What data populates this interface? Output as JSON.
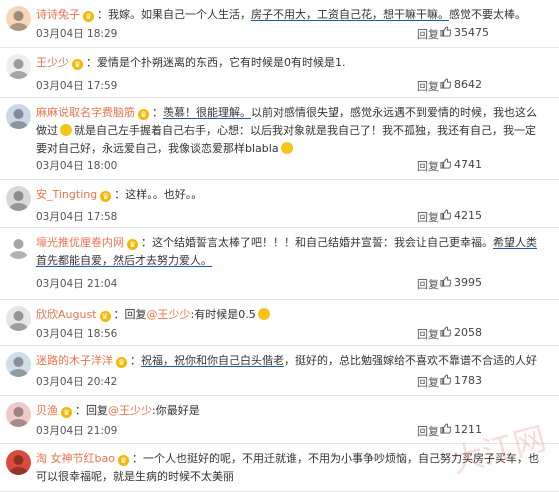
{
  "labels": {
    "reply": "回复"
  },
  "colors": {
    "username": "#eb7350",
    "vip": "#f7b600",
    "underline": "#1b5ea8",
    "divider": "#e6e6e6"
  },
  "watermark_text": "大江网",
  "comments": [
    {
      "user": "诗诗兔子",
      "parts": [
        {
          "t": "：我嫁。如果自己一个人生活，"
        },
        {
          "t": "房子不用大，工资自己花，想干嘛干嘛。",
          "hl": true
        },
        {
          "t": "感觉不要太棒。"
        }
      ],
      "time": "03月04日 18:29",
      "likes": "35475"
    },
    {
      "user": "王少少",
      "parts": [
        {
          "t": "：爱情是个扑朔迷离的东西，它有时候是0有时候是1."
        }
      ],
      "time": "03月04日 17:59",
      "likes": "8642"
    },
    {
      "user": "麻麻说取名字费脑筋",
      "parts": [
        {
          "t": "："
        },
        {
          "t": "羡慕！很能理解。",
          "hl": true
        },
        {
          "t": "以前对感情很失望，感觉永远遇不到爱情的时候，我也这么做过"
        },
        {
          "emoji": true
        },
        {
          "t": "就是自己左手握着自己右手，心想：以后我对象就是我自己了！我不孤独，我还有自己，我一定要对自己好，永远爱自己，我像谈恋爱那样blabla"
        },
        {
          "emoji": true
        }
      ],
      "time": "03月04日 18:00",
      "likes": "4741"
    },
    {
      "user": "安_Tingting",
      "parts": [
        {
          "t": "：这样。。也好。。"
        }
      ],
      "time": "03月04日 17:58",
      "likes": "4215"
    },
    {
      "user": "壕光推优厘卷内网",
      "parts": [
        {
          "t": "：这个结婚誓言太棒了吧！！！和自己结婚并宣誓：我会让自己更幸福。"
        },
        {
          "t": "希望人类首先都能自爱，然后才去努力爱人。",
          "hl": true
        }
      ],
      "time": "03月04日 21:04",
      "likes": "3995"
    },
    {
      "user": "欣欣August",
      "parts": [
        {
          "t": "：回复"
        },
        {
          "u": "@王少少"
        },
        {
          "t": ":有时候是0.5"
        },
        {
          "emoji": true
        }
      ],
      "time": "03月04日 18:56",
      "likes": "2058"
    },
    {
      "user": "迷路的木子洋洋",
      "parts": [
        {
          "t": "："
        },
        {
          "t": "祝福，祝你和你自己白头偕老",
          "hl": true
        },
        {
          "t": "，挺好的，总比勉强嫁给不喜欢不靠谱不合适的人好"
        }
      ],
      "time": "03月04日 20:42",
      "likes": "1783"
    },
    {
      "user": "贝渔",
      "parts": [
        {
          "t": "：回复"
        },
        {
          "u": "@王少少"
        },
        {
          "t": ":你最好是"
        }
      ],
      "time": "03月04日 21:09",
      "likes": "1211"
    },
    {
      "user": "淘 女神节红bao",
      "parts": [
        {
          "t": "：一个人也挺好的呢，不用迁就谁，不用为小事争吵烦恼，自己努力买房子买车，也可以很幸福呢，就是生病的时候不太美丽"
        }
      ],
      "time": "",
      "likes": ""
    }
  ]
}
